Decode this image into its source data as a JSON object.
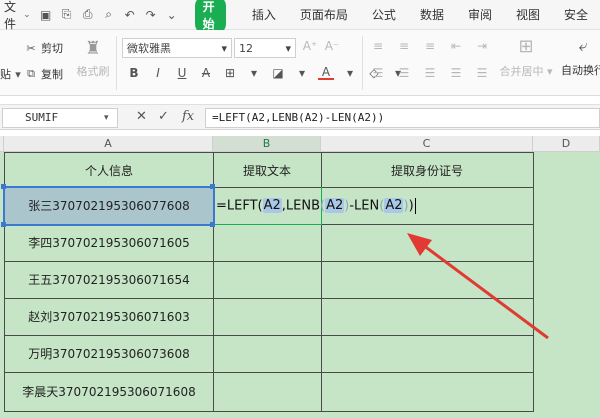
{
  "menubar": {
    "file_label": "文件",
    "start_label": "开始",
    "items": [
      "插入",
      "页面布局",
      "公式",
      "数据",
      "审阅",
      "视图",
      "安全"
    ]
  },
  "ribbon": {
    "cut_label": "剪切",
    "copy_label": "复制",
    "format_painter_label": "格式刷",
    "paste_label_partial": "贴",
    "font_name": "微软雅黑",
    "font_size": "12",
    "merge_center_label": "合并居中",
    "auto_wrap_label": "自动换行",
    "format_buttons": [
      "B",
      "I",
      "U",
      "A",
      "A"
    ]
  },
  "formula_bar": {
    "name_box": "SUMIF",
    "formula": "=LEFT(A2,LENB(A2)-LEN(A2))"
  },
  "columns": [
    "A",
    "B",
    "C",
    "D"
  ],
  "headers": {
    "a1": "个人信息",
    "b1": "提取文本",
    "c1": "提取身份证号"
  },
  "rows": [
    "张三370702195306077608",
    "李四370702195306071605",
    "王五370702195306071654",
    "赵刘370702195306071603",
    "万明370702195306073608",
    "李晨天370702195306071608"
  ],
  "editing_cell": {
    "tokens": [
      "=LEFT(",
      "A2",
      ",LENB",
      "(",
      "A2",
      ")",
      "-LEN",
      "(",
      "A2",
      ")",
      ")"
    ]
  },
  "colors": {
    "sheet_background": "#c6e5c6",
    "selected_cell": "#aac6cc",
    "reference_highlight": "#a9c7e6",
    "start_tab": "#1aad52",
    "arrow": "#e03a32"
  }
}
